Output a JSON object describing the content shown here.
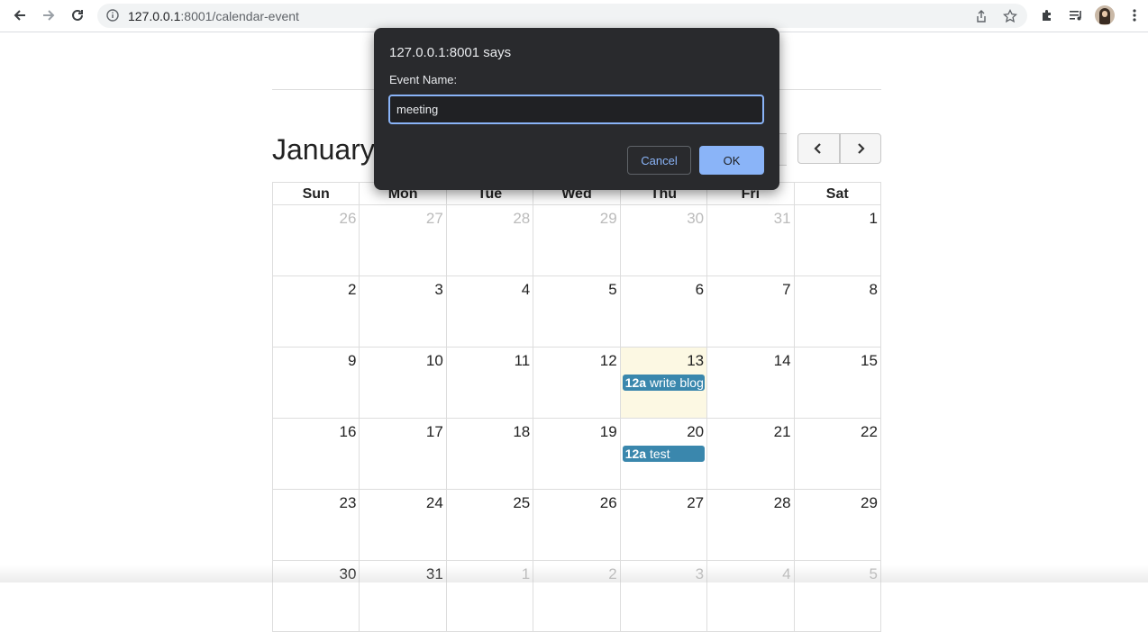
{
  "browser": {
    "url_host": "127.0.0.1",
    "url_rest": ":8001/calendar-event"
  },
  "calendar": {
    "title": "January",
    "weekdays": [
      "Sun",
      "Mon",
      "Tue",
      "Wed",
      "Thu",
      "Fri",
      "Sat"
    ],
    "weeks": [
      [
        {
          "d": "26",
          "o": true
        },
        {
          "d": "27",
          "o": true
        },
        {
          "d": "28",
          "o": true
        },
        {
          "d": "29",
          "o": true
        },
        {
          "d": "30",
          "o": true
        },
        {
          "d": "31",
          "o": true
        },
        {
          "d": "1"
        }
      ],
      [
        {
          "d": "2"
        },
        {
          "d": "3"
        },
        {
          "d": "4"
        },
        {
          "d": "5"
        },
        {
          "d": "6"
        },
        {
          "d": "7"
        },
        {
          "d": "8"
        }
      ],
      [
        {
          "d": "9"
        },
        {
          "d": "10"
        },
        {
          "d": "11"
        },
        {
          "d": "12"
        },
        {
          "d": "13",
          "today": true,
          "event": {
            "time": "12a",
            "title": "write blog"
          }
        },
        {
          "d": "14"
        },
        {
          "d": "15"
        }
      ],
      [
        {
          "d": "16"
        },
        {
          "d": "17"
        },
        {
          "d": "18"
        },
        {
          "d": "19"
        },
        {
          "d": "20",
          "event": {
            "time": "12a",
            "title": "test"
          }
        },
        {
          "d": "21"
        },
        {
          "d": "22"
        }
      ],
      [
        {
          "d": "23"
        },
        {
          "d": "24"
        },
        {
          "d": "25"
        },
        {
          "d": "26"
        },
        {
          "d": "27"
        },
        {
          "d": "28"
        },
        {
          "d": "29"
        }
      ],
      [
        {
          "d": "30"
        },
        {
          "d": "31"
        },
        {
          "d": "1",
          "o": true
        },
        {
          "d": "2",
          "o": true
        },
        {
          "d": "3",
          "o": true
        },
        {
          "d": "4",
          "o": true
        },
        {
          "d": "5",
          "o": true
        }
      ]
    ],
    "colors": {
      "event": "#3a87ad",
      "today": "#fcf8e3"
    }
  },
  "dialog": {
    "title": "127.0.0.1:8001 says",
    "message": "Event Name:",
    "input_value": "meeting",
    "cancel_label": "Cancel",
    "ok_label": "OK",
    "accent": "#8ab4f8"
  }
}
